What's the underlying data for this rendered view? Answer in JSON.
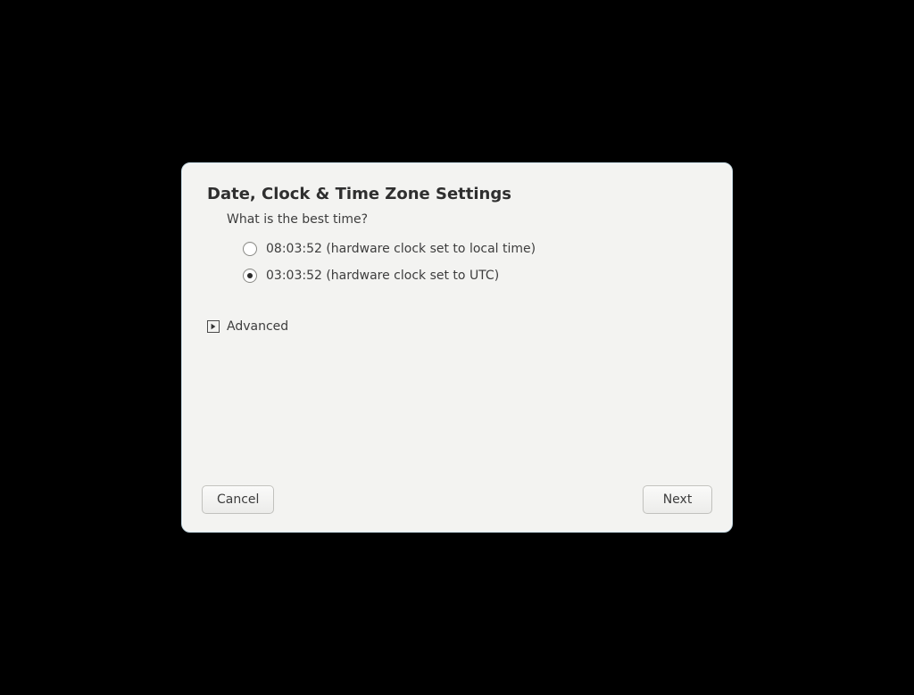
{
  "dialog": {
    "title": "Date, Clock & Time Zone Settings",
    "subtitle": "What is the best time?",
    "options": [
      {
        "label": "08:03:52 (hardware clock set to local time)",
        "selected": false
      },
      {
        "label": "03:03:52 (hardware clock set to UTC)",
        "selected": true
      }
    ],
    "advanced_label": "Advanced",
    "buttons": {
      "cancel": "Cancel",
      "next": "Next"
    }
  }
}
